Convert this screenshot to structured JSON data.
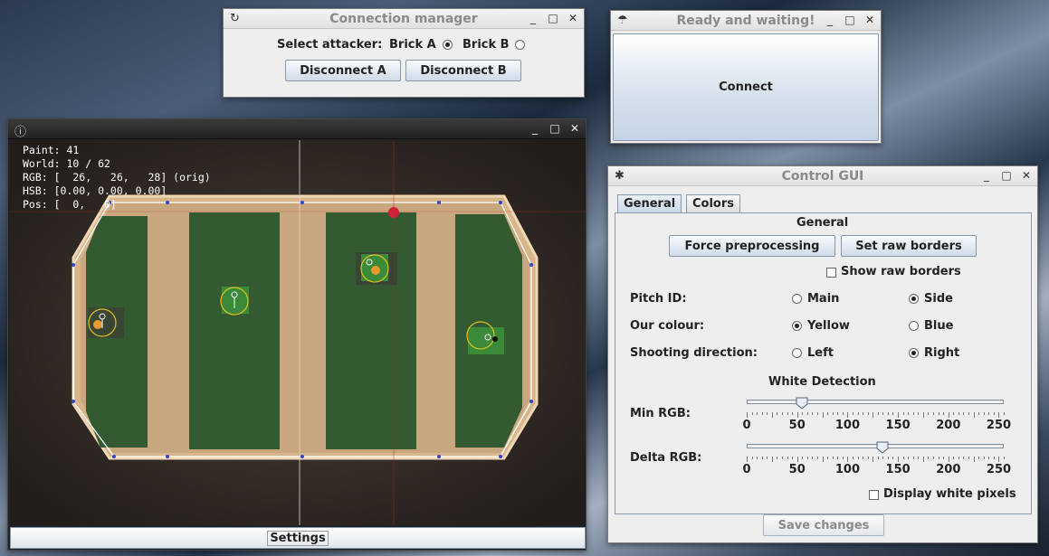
{
  "connection_manager": {
    "title": "Connection manager",
    "attacker_label": "Select attacker:",
    "brick_a": "Brick A",
    "brick_b": "Brick B",
    "disconnect_a": "Disconnect A",
    "disconnect_b": "Disconnect B",
    "selected": "Brick A"
  },
  "ready_window": {
    "title": "Ready and waiting!",
    "connect": "Connect"
  },
  "camera": {
    "overlay": {
      "paint": "Paint: 41",
      "world": "World: 10 / 62",
      "rgb": "RGB: [  26,   26,   28] (orig)",
      "hsb": "HSB: [0.00, 0.00, 0.00]",
      "pos": "Pos: [  0,   0]"
    },
    "settings": "Settings"
  },
  "control_gui": {
    "title": "Control GUI",
    "tabs": [
      "General",
      "Colors"
    ],
    "section_title": "General",
    "force_preprocessing": "Force preprocessing",
    "set_raw_borders": "Set raw borders",
    "show_raw_borders": "Show raw borders",
    "pitch_id": {
      "label": "Pitch ID:",
      "opt1": "Main",
      "opt2": "Side",
      "selected": "Side"
    },
    "our_colour": {
      "label": "Our colour:",
      "opt1": "Yellow",
      "opt2": "Blue",
      "selected": "Yellow"
    },
    "shooting": {
      "label": "Shooting direction:",
      "opt1": "Left",
      "opt2": "Right",
      "selected": "Right"
    },
    "white_detection": "White Detection",
    "min_rgb": {
      "label": "Min RGB:",
      "value": 55
    },
    "delta_rgb": {
      "label": "Delta RGB:",
      "value": 135
    },
    "slider_ticks": [
      "0",
      "50",
      "100",
      "150",
      "200",
      "250"
    ],
    "display_white_pixels": "Display white pixels",
    "save_changes": "Save changes"
  }
}
